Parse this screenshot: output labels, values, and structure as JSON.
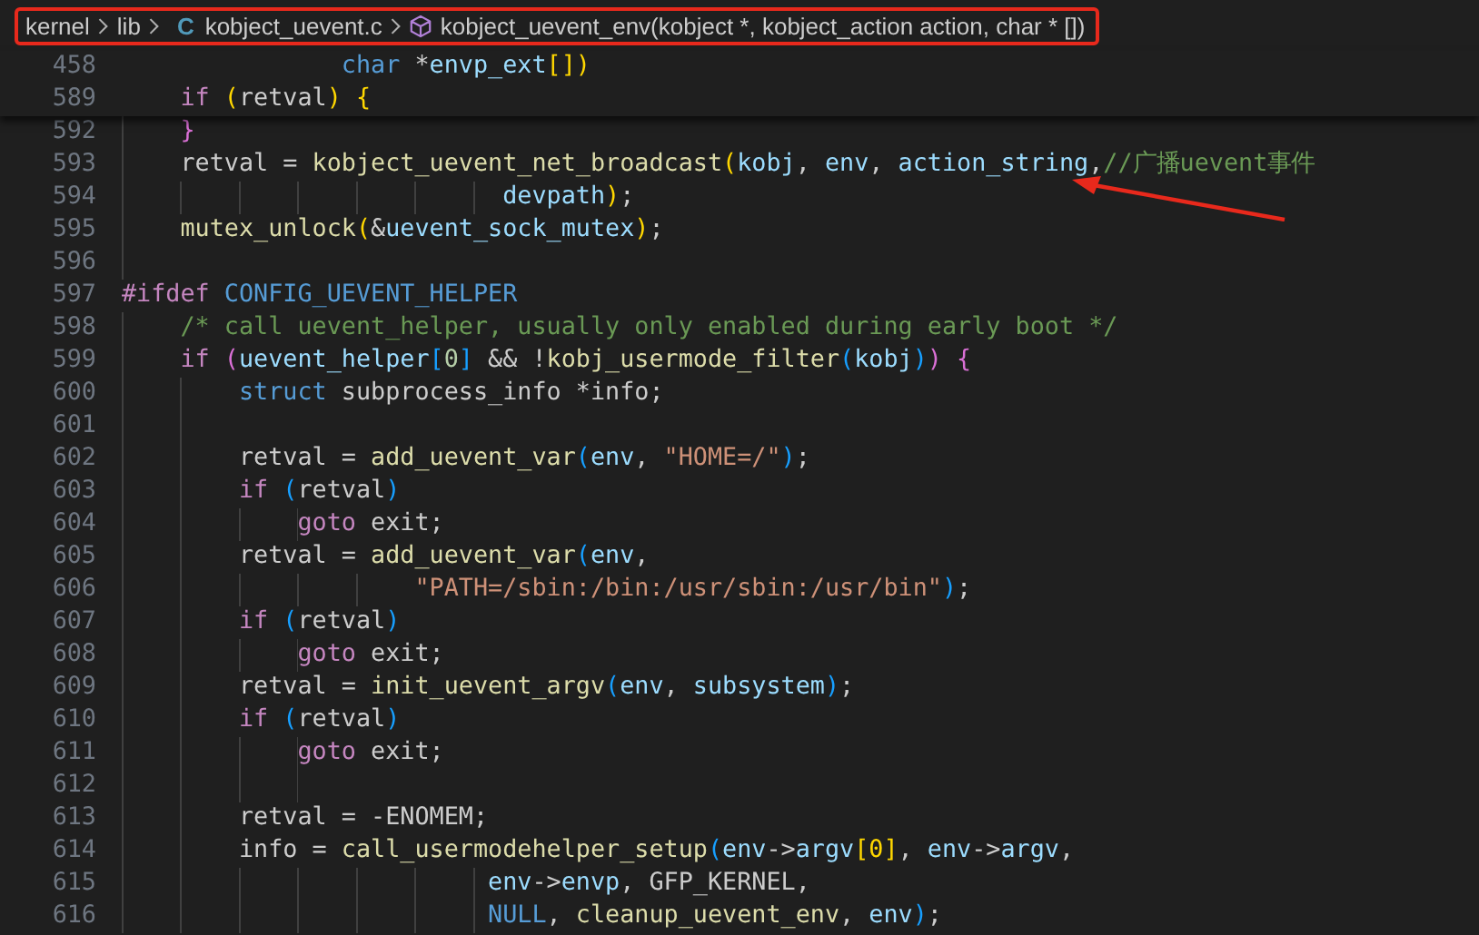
{
  "breadcrumb": {
    "items": [
      {
        "kind": "folder",
        "label": "kernel"
      },
      {
        "kind": "folder",
        "label": "lib"
      },
      {
        "kind": "file",
        "label": "kobject_uevent.c",
        "icon": "C"
      },
      {
        "kind": "symbol",
        "label": "kobject_uevent_env(kobject *, kobject_action action, char * [])"
      }
    ]
  },
  "sticky_lines": [
    {
      "number": "458",
      "tokens": [
        {
          "kind": "type",
          "text": "               char"
        },
        {
          "kind": "plain",
          "text": " *"
        },
        {
          "kind": "param",
          "text": "envp_ext"
        },
        {
          "kind": "br1",
          "text": "[])"
        }
      ]
    },
    {
      "number": "589",
      "tokens": [
        {
          "kind": "kw",
          "text": "    if"
        },
        {
          "kind": "br1",
          "text": " ("
        },
        {
          "kind": "plain",
          "text": "retval"
        },
        {
          "kind": "br1",
          "text": ") {"
        }
      ]
    }
  ],
  "lines": [
    {
      "number": "592",
      "tokens": [
        {
          "kind": "br2",
          "text": "    }"
        }
      ]
    },
    {
      "number": "593",
      "tokens": [
        {
          "kind": "plain",
          "text": "    retval = "
        },
        {
          "kind": "fn",
          "text": "kobject_uevent_net_broadcast"
        },
        {
          "kind": "br1",
          "text": "("
        },
        {
          "kind": "param",
          "text": "kobj"
        },
        {
          "kind": "plain",
          "text": ", "
        },
        {
          "kind": "param",
          "text": "env"
        },
        {
          "kind": "plain",
          "text": ", "
        },
        {
          "kind": "param",
          "text": "action_string"
        },
        {
          "kind": "plain",
          "text": ","
        },
        {
          "kind": "comment",
          "text": "//广播uevent事件"
        }
      ]
    },
    {
      "number": "594",
      "tokens": [
        {
          "kind": "param",
          "text": "                          devpath"
        },
        {
          "kind": "br1",
          "text": ")"
        },
        {
          "kind": "plain",
          "text": ";"
        }
      ]
    },
    {
      "number": "595",
      "tokens": [
        {
          "kind": "fn",
          "text": "    mutex_unlock"
        },
        {
          "kind": "br1",
          "text": "("
        },
        {
          "kind": "plain",
          "text": "&"
        },
        {
          "kind": "param",
          "text": "uevent_sock_mutex"
        },
        {
          "kind": "br1",
          "text": ")"
        },
        {
          "kind": "plain",
          "text": ";"
        }
      ]
    },
    {
      "number": "596"
    },
    {
      "number": "597",
      "tokens": [
        {
          "kind": "kw",
          "text": "#ifdef"
        },
        {
          "kind": "macro",
          "text": " CONFIG_UEVENT_HELPER"
        }
      ]
    },
    {
      "number": "598",
      "tokens": [
        {
          "kind": "comment",
          "text": "    /* call uevent_helper, usually only enabled during early boot */"
        }
      ]
    },
    {
      "number": "599",
      "tokens": [
        {
          "kind": "kw",
          "text": "    if"
        },
        {
          "kind": "br2",
          "text": " ("
        },
        {
          "kind": "param",
          "text": "uevent_helper"
        },
        {
          "kind": "br3",
          "text": "["
        },
        {
          "kind": "num",
          "text": "0"
        },
        {
          "kind": "br3",
          "text": "]"
        },
        {
          "kind": "plain",
          "text": " && !"
        },
        {
          "kind": "fn",
          "text": "kobj_usermode_filter"
        },
        {
          "kind": "br3",
          "text": "("
        },
        {
          "kind": "param",
          "text": "kobj"
        },
        {
          "kind": "br3",
          "text": ")"
        },
        {
          "kind": "br2",
          "text": ") {"
        }
      ]
    },
    {
      "number": "600",
      "tokens": [
        {
          "kind": "type",
          "text": "        struct"
        },
        {
          "kind": "plain",
          "text": " subprocess_info *info;"
        }
      ]
    },
    {
      "number": "601"
    },
    {
      "number": "602",
      "tokens": [
        {
          "kind": "plain",
          "text": "        retval = "
        },
        {
          "kind": "fn",
          "text": "add_uevent_var"
        },
        {
          "kind": "br3",
          "text": "("
        },
        {
          "kind": "param",
          "text": "env"
        },
        {
          "kind": "plain",
          "text": ","
        },
        {
          "kind": "str",
          "text": " \"HOME=/\""
        },
        {
          "kind": "br3",
          "text": ")"
        },
        {
          "kind": "plain",
          "text": ";"
        }
      ]
    },
    {
      "number": "603",
      "tokens": [
        {
          "kind": "kw",
          "text": "        if"
        },
        {
          "kind": "br3",
          "text": " ("
        },
        {
          "kind": "plain",
          "text": "retval"
        },
        {
          "kind": "br3",
          "text": ")"
        }
      ]
    },
    {
      "number": "604",
      "tokens": [
        {
          "kind": "kw",
          "text": "            goto"
        },
        {
          "kind": "plain",
          "text": " exit;"
        }
      ]
    },
    {
      "number": "605",
      "tokens": [
        {
          "kind": "plain",
          "text": "        retval = "
        },
        {
          "kind": "fn",
          "text": "add_uevent_var"
        },
        {
          "kind": "br3",
          "text": "("
        },
        {
          "kind": "param",
          "text": "env"
        },
        {
          "kind": "plain",
          "text": ","
        }
      ]
    },
    {
      "number": "606",
      "tokens": [
        {
          "kind": "str",
          "text": "                    \"PATH=/sbin:/bin:/usr/sbin:/usr/bin\""
        },
        {
          "kind": "br3",
          "text": ")"
        },
        {
          "kind": "plain",
          "text": ";"
        }
      ]
    },
    {
      "number": "607",
      "tokens": [
        {
          "kind": "kw",
          "text": "        if"
        },
        {
          "kind": "br3",
          "text": " ("
        },
        {
          "kind": "plain",
          "text": "retval"
        },
        {
          "kind": "br3",
          "text": ")"
        }
      ]
    },
    {
      "number": "608",
      "tokens": [
        {
          "kind": "kw",
          "text": "            goto"
        },
        {
          "kind": "plain",
          "text": " exit;"
        }
      ]
    },
    {
      "number": "609",
      "tokens": [
        {
          "kind": "plain",
          "text": "        retval = "
        },
        {
          "kind": "fn",
          "text": "init_uevent_argv"
        },
        {
          "kind": "br3",
          "text": "("
        },
        {
          "kind": "param",
          "text": "env"
        },
        {
          "kind": "plain",
          "text": ","
        },
        {
          "kind": "param",
          "text": " subsystem"
        },
        {
          "kind": "br3",
          "text": ")"
        },
        {
          "kind": "plain",
          "text": ";"
        }
      ]
    },
    {
      "number": "610",
      "tokens": [
        {
          "kind": "kw",
          "text": "        if"
        },
        {
          "kind": "br3",
          "text": " ("
        },
        {
          "kind": "plain",
          "text": "retval"
        },
        {
          "kind": "br3",
          "text": ")"
        }
      ]
    },
    {
      "number": "611",
      "tokens": [
        {
          "kind": "kw",
          "text": "            goto"
        },
        {
          "kind": "plain",
          "text": " exit;"
        }
      ]
    },
    {
      "number": "612"
    },
    {
      "number": "613",
      "tokens": [
        {
          "kind": "plain",
          "text": "        retval = -ENOMEM;"
        }
      ]
    },
    {
      "number": "614",
      "tokens": [
        {
          "kind": "plain",
          "text": "        info = "
        },
        {
          "kind": "fn",
          "text": "call_usermodehelper_setup"
        },
        {
          "kind": "br3",
          "text": "("
        },
        {
          "kind": "param",
          "text": "env"
        },
        {
          "kind": "plain",
          "text": "->"
        },
        {
          "kind": "param",
          "text": "argv"
        },
        {
          "kind": "br1",
          "text": "[0]"
        },
        {
          "kind": "plain",
          "text": ","
        },
        {
          "kind": "param",
          "text": " env"
        },
        {
          "kind": "plain",
          "text": "->"
        },
        {
          "kind": "param",
          "text": "argv"
        },
        {
          "kind": "plain",
          "text": ","
        }
      ]
    },
    {
      "number": "615",
      "tokens": [
        {
          "kind": "param",
          "text": "                         env"
        },
        {
          "kind": "plain",
          "text": "->"
        },
        {
          "kind": "param",
          "text": "envp"
        },
        {
          "kind": "plain",
          "text": ", GFP_KERNEL,"
        }
      ]
    },
    {
      "number": "616",
      "tokens": [
        {
          "kind": "macro",
          "text": "                         NULL"
        },
        {
          "kind": "plain",
          "text": ","
        },
        {
          "kind": "fn",
          "text": " cleanup_uevent_env"
        },
        {
          "kind": "plain",
          "text": ","
        },
        {
          "kind": "param",
          "text": " env"
        },
        {
          "kind": "br3",
          "text": ")"
        },
        {
          "kind": "plain",
          "text": ";"
        }
      ]
    }
  ]
}
